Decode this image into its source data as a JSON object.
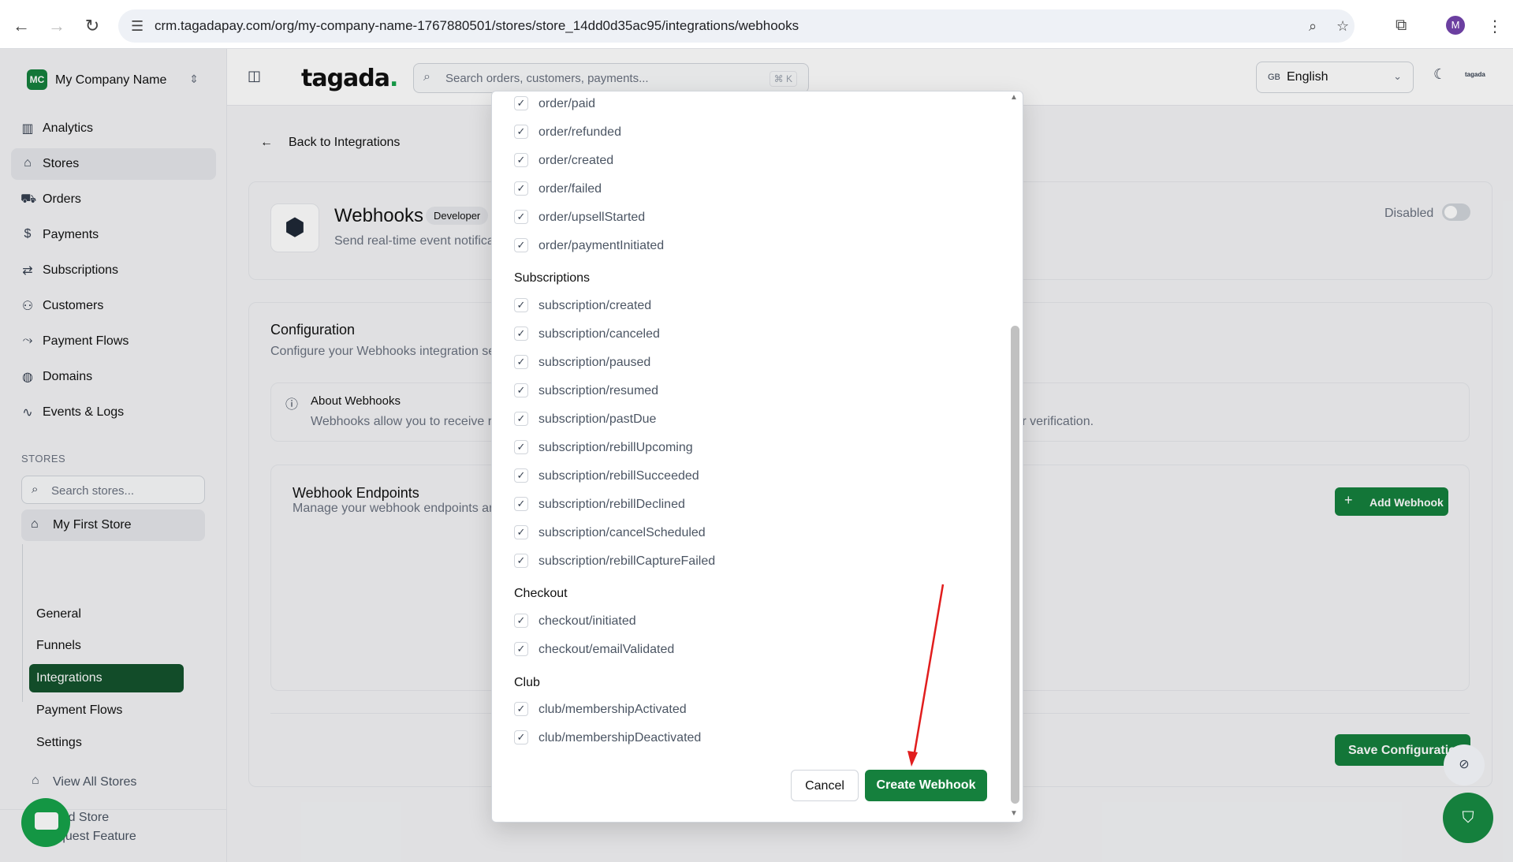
{
  "browser": {
    "url": "crm.tagadapay.com/org/my-company-name-1767880501/stores/store_14dd0d35ac95/integrations/webhooks",
    "profile_initial": "M"
  },
  "app": {
    "logo": "tagada",
    "logo_dot": ".",
    "search_placeholder": "Search orders, customers, payments...",
    "search_shortcut": "⌘ K",
    "language_flag": "GB",
    "language": "English"
  },
  "sidebar": {
    "company_initials": "MC",
    "company_name": "My Company Name",
    "items": [
      {
        "label": "Analytics",
        "icon": "bar-chart-icon"
      },
      {
        "label": "Stores",
        "icon": "store-icon"
      },
      {
        "label": "Orders",
        "icon": "cart-icon"
      },
      {
        "label": "Payments",
        "icon": "dollar-icon"
      },
      {
        "label": "Subscriptions",
        "icon": "repeat-icon"
      },
      {
        "label": "Customers",
        "icon": "users-icon"
      },
      {
        "label": "Payment Flows",
        "icon": "flow-icon"
      },
      {
        "label": "Domains",
        "icon": "globe-icon"
      },
      {
        "label": "Events & Logs",
        "icon": "activity-icon"
      }
    ],
    "stores_label": "STORES",
    "store_search_placeholder": "Search stores...",
    "store_name": "My First Store",
    "store_subnav": [
      "General",
      "Funnels",
      "Integrations",
      "Payment Flows",
      "Settings"
    ],
    "view_all": "View All Stores",
    "add_store": "Add Store",
    "request_feature": "quest Feature"
  },
  "page": {
    "back_label": "Back to Integrations",
    "title": "Webhooks",
    "badge": "Developer",
    "subtitle": "Send real-time event notifica",
    "status": "Disabled",
    "config_title": "Configuration",
    "config_sub": "Configure your Webhooks integration se",
    "about_title": "About Webhooks",
    "about_text": "Webhooks allow you to receive r",
    "about_tail": "for verification.",
    "endpoints_title": "Webhook Endpoints",
    "endpoints_sub": "Manage your webhook endpoints ar",
    "add_webhook": "Add Webhook",
    "save_config": "Save Configuratio"
  },
  "modal": {
    "order_events": [
      "order/paid",
      "order/refunded",
      "order/created",
      "order/failed",
      "order/upsellStarted",
      "order/paymentInitiated"
    ],
    "subscriptions_heading": "Subscriptions",
    "subscription_events": [
      "subscription/created",
      "subscription/canceled",
      "subscription/paused",
      "subscription/resumed",
      "subscription/pastDue",
      "subscription/rebillUpcoming",
      "subscription/rebillSucceeded",
      "subscription/rebillDeclined",
      "subscription/cancelScheduled",
      "subscription/rebillCaptureFailed"
    ],
    "checkout_heading": "Checkout",
    "checkout_events": [
      "checkout/initiated",
      "checkout/emailValidated"
    ],
    "club_heading": "Club",
    "club_events": [
      "club/membershipActivated",
      "club/membershipDeactivated"
    ],
    "cancel_label": "Cancel",
    "create_label": "Create Webhook"
  },
  "colors": {
    "brand_green": "#15803d",
    "annotation_arrow": "#e11d1d"
  }
}
